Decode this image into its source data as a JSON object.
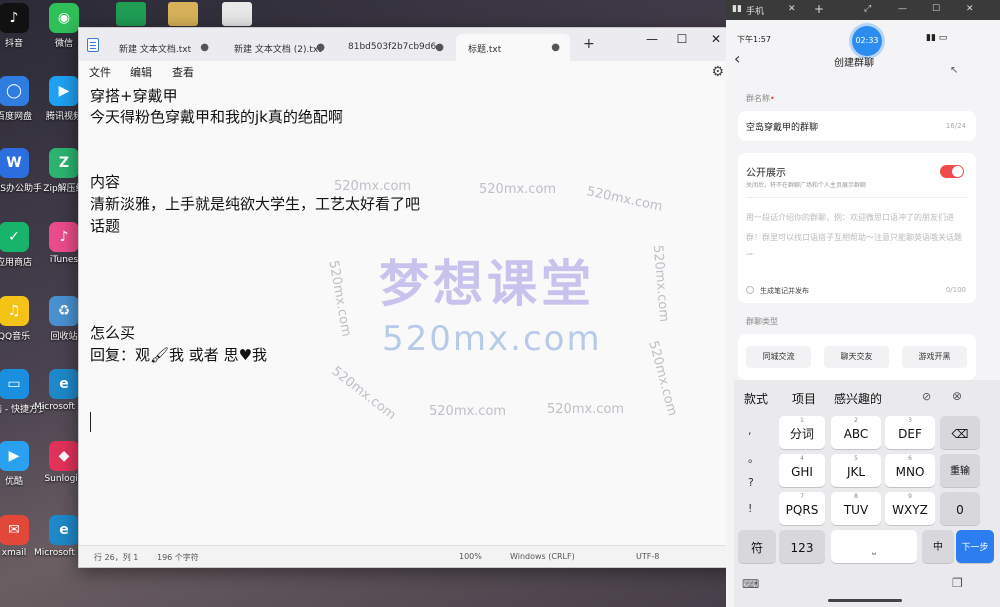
{
  "desktop": {
    "icons": [
      {
        "label": "抖音",
        "glyph": "♪",
        "color": "#111111"
      },
      {
        "label": "百度网盘",
        "glyph": "◯",
        "color": "#2f7de1"
      },
      {
        "label": "WPS办公助手",
        "glyph": "W",
        "color": "#2c6ee0"
      },
      {
        "label": "应用商店",
        "glyph": "✓",
        "color": "#18b46b"
      },
      {
        "label": "QQ音乐",
        "glyph": "♫",
        "color": "#f3c318"
      },
      {
        "label": "电脑 - 快捷方式",
        "glyph": "▭",
        "color": "#1a8fe0"
      },
      {
        "label": "优酷",
        "glyph": "▶",
        "color": "#2aa0f0"
      },
      {
        "label": "xmail",
        "glyph": "✉",
        "color": "#e2473a"
      },
      {
        "label": "微信",
        "glyph": "◉",
        "color": "#2fc05a"
      },
      {
        "label": "腾讯视频",
        "glyph": "▶",
        "color": "#1ea1f2"
      },
      {
        "label": "Zip解压缩",
        "glyph": "Z",
        "color": "#2bb36f"
      },
      {
        "label": "iTunes",
        "glyph": "♪",
        "color": "#ea4c89"
      },
      {
        "label": "回收站",
        "glyph": "♻",
        "color": "#4a90d0"
      },
      {
        "label": "Microsoft Edge",
        "glyph": "e",
        "color": "#1e88c8"
      },
      {
        "label": "Sunlogin",
        "glyph": "◆",
        "color": "#e2325a"
      },
      {
        "label": "Microsoft Edge",
        "glyph": "e",
        "color": "#1e88c8"
      }
    ]
  },
  "notepad": {
    "tabs": [
      {
        "label": "新建 文本文档.txt"
      },
      {
        "label": "新建 文本文档 (2).txt"
      },
      {
        "label": "81bd503f2b7cb9d6("
      },
      {
        "label": "标题.txt"
      }
    ],
    "menu": {
      "file": "文件",
      "edit": "编辑",
      "view": "查看"
    },
    "lines": [
      "穿搭+穿戴甲",
      "今天得粉色穿戴甲和我的jk真的绝配啊",
      "内容",
      "清新淡雅，上手就是纯欲大学生，工艺太好看了吧",
      "话题",
      "怎么买",
      "回复：观🖌我    或者    思♥我"
    ],
    "status": {
      "position": "行 26，列 1",
      "chars": "196 个字符",
      "zoom": "100%",
      "eol": "Windows (CRLF)",
      "encoding": "UTF-8"
    }
  },
  "watermark": {
    "small": "520mx.com",
    "main": "梦想课堂",
    "url": "520mx.com"
  },
  "phone": {
    "topbar_title": "手机",
    "time": "下午1:57",
    "timer": "02:33",
    "title": "创建群聊",
    "group_name_label": "群名称",
    "group_name_value": "空岛穿戴甲的群聊",
    "group_name_count": "16/24",
    "public_title": "公开展示",
    "public_desc": "关闭后，将不在群聊广场和个人主页展示群聊",
    "intro_placeholder": "用一段话介绍你的群聊，例：欢迎微思口语冲了的朋友们进群！群里可以找口语搭子互相帮助～注意只能聊英语哦关话题哦",
    "note_label": "生成笔记并发布",
    "note_count": "0/100",
    "type_label": "群聊类型",
    "chips": [
      "同城交流",
      "聊天交友",
      "游戏开黑"
    ],
    "keyboard": {
      "suggestions": [
        "款式",
        "项目",
        "感兴趣的"
      ],
      "side_symbols": [
        ",",
        "。",
        "?",
        "!"
      ],
      "rows": [
        [
          {
            "num": "1",
            "label": "分词"
          },
          {
            "num": "2",
            "label": "ABC"
          },
          {
            "num": "3",
            "label": "DEF"
          }
        ],
        [
          {
            "num": "4",
            "label": "GHI"
          },
          {
            "num": "5",
            "label": "JKL"
          },
          {
            "num": "6",
            "label": "MNO"
          }
        ],
        [
          {
            "num": "7",
            "label": "PQRS"
          },
          {
            "num": "8",
            "label": "TUV"
          },
          {
            "num": "9",
            "label": "WXYZ"
          }
        ]
      ],
      "retype": "重输",
      "zero": "0",
      "symbols": "符",
      "numbers": "123",
      "lang": "中",
      "next": "下一步"
    }
  }
}
